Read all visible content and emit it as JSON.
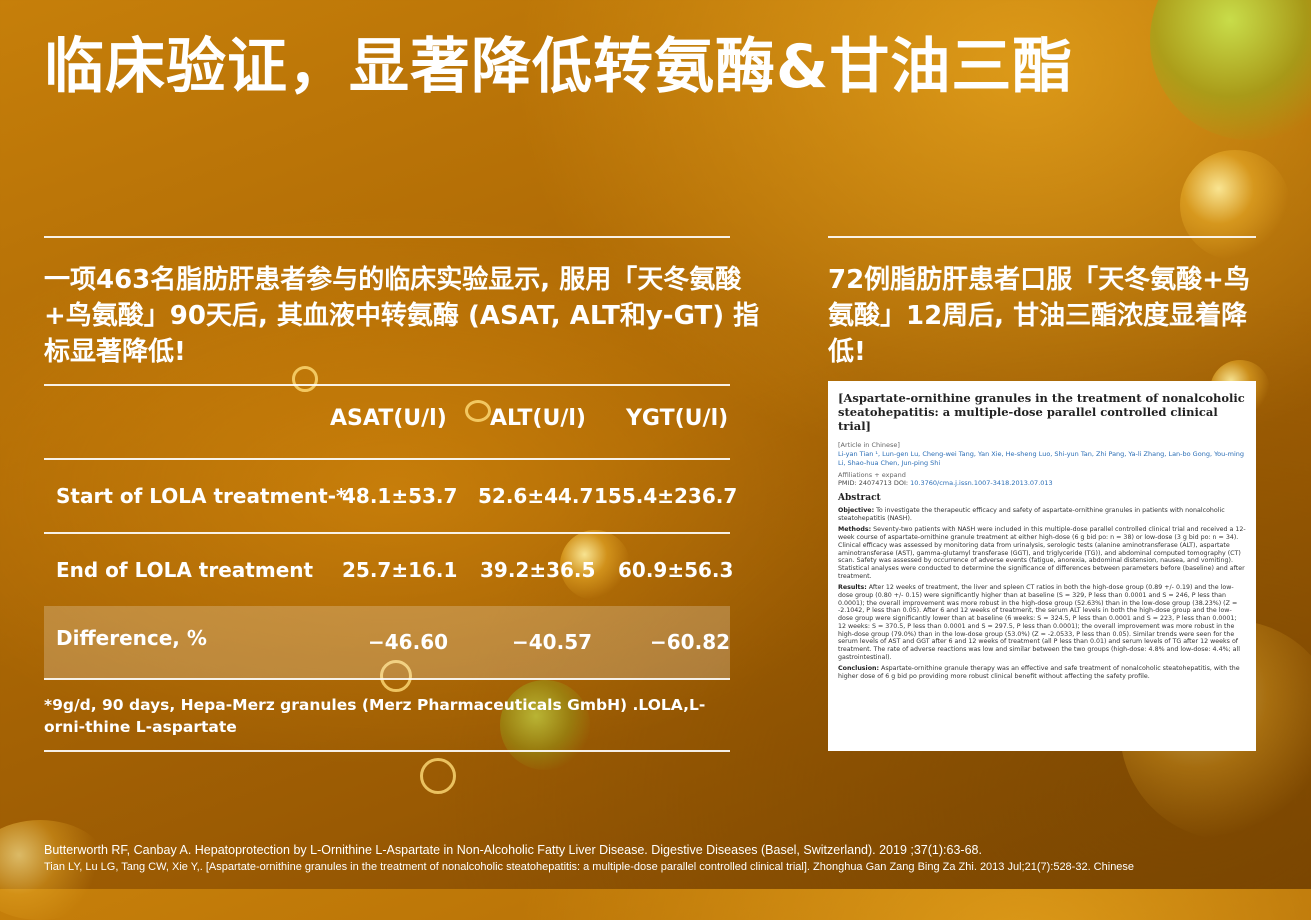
{
  "title": "临床验证，显著降低转氨酶&甘油三酯",
  "left": {
    "lead": "一项463名脂肪肝患者参与的临床实验显示, 服用「天冬氨酸+鸟氨酸」90天后, 其血液中转氨酶 (ASAT, ALT和y-GT) 指标显著降低!",
    "table": {
      "headers": [
        "",
        "ASAT(U/l)",
        "ALT(U/l)",
        "YGT(U/l)"
      ],
      "rows": [
        {
          "label": "Start of LOLA treatment-*",
          "values": [
            "48.1±53.7",
            "52.6±44.7",
            "155.4±236.7"
          ]
        },
        {
          "label": "End of LOLA treatment",
          "values": [
            "25.7±16.1",
            "39.2±36.5",
            "60.9±56.3"
          ]
        },
        {
          "label": "Difference, %",
          "values": [
            "−46.60",
            "−40.57",
            "−60.82"
          ]
        }
      ]
    },
    "footnote": "*9g/d, 90  days, Hepa-Merz  granules (Merz  Pharmaceuticals  GmbH) .LOLA,L-orni-thine L-aspartate"
  },
  "right": {
    "lead": "72例脂肪肝患者口服「天冬氨酸+鸟氨酸」12周后, 甘油三酯浓度显着降低!",
    "paper": {
      "title": "[Aspartate-ornithine granules in the treatment of nonalcoholic steatohepatitis: a multiple-dose parallel controlled clinical trial]",
      "article_lang": "[Article in Chinese]",
      "authors": "Li-yan Tian ¹, Lun-gen Lu, Cheng-wei Tang, Yan Xie, He-sheng Luo, Shi-yun Tan, Zhi Pang, Ya-li Zhang, Lan-bo Gong, You-ming Li, Shao-hua Chen, Jun-ping Shi",
      "affiliations": "Affiliations  + expand",
      "pmid_label": "PMID: 24074713   DOI: ",
      "doi": "10.3760/cma.j.issn.1007-3418.2013.07.013",
      "abstract_heading": "Abstract",
      "objective_label": "Objective:",
      "objective": " To investigate the therapeutic efficacy and safety of aspartate-ornithine granules in patients with nonalcoholic steatohepatitis (NASH).",
      "methods_label": "Methods:",
      "methods": " Seventy-two patients with NASH were included in this multiple-dose parallel controlled clinical trial and received a 12-week course of aspartate-ornithine granule treatment at either high-dose (6 g bid po: n = 38) or low-dose (3 g bid po: n = 34). Clinical efficacy was assessed by monitoring data from urinalysis, serologic tests (alanine aminotransferase (ALT), aspartate aminotransferase (AST), gamma-glutamyl transferase (GGT), and triglyceride (TG)), and abdominal computed tomography (CT) scan. Safety was assessed by occurrence of adverse events (fatigue, anorexia, abdominal distension, nausea, and vomiting). Statistical analyses were conducted to determine the significance of differences between parameters before (baseline) and after treatment.",
      "results_label": "Results:",
      "results": " After 12 weeks of treatment, the liver and spleen CT ratios in both the high-dose group (0.89 +/- 0.19) and the low-dose group (0.80 +/- 0.15) were significantly higher than at baseline (S = 329, P less than 0.0001 and S = 246, P less than 0.0001); the overall improvement was more robust in the high-dose group (52.63%) than in the low-dose group (38.23%) (Z = -2.1042, P less than 0.05). After 6 and 12 weeks of treatment, the serum ALT levels in both the high-dose group and the low-dose group were significantly lower than at baseline (6 weeks: S = 324.5, P less than 0.0001 and S = 223, P less than 0.0001; 12 weeks: S = 370.5, P less than 0.0001 and S = 297.5, P less than 0.0001); the overall improvement was more robust in the high-dose group (79.0%) than in the low-dose group (53.0%) (Z = -2.0533, P less than 0.05). Similar trends were seen for the serum levels of AST and GGT after 6 and 12 weeks of treatment (all P less than 0.01) and serum levels of TG after 12 weeks of treatment. The rate of adverse reactions was low and similar between the two groups (high-dose: 4.8% and low-dose: 4.4%; all gastrointestinal).",
      "conclusion_label": "Conclusion:",
      "conclusion": " Aspartate-ornithine granule therapy was an effective and safe treatment of nonalcoholic steatohepatitis, with the higher dose of 6 g bid po providing more robust clinical benefit without affecting the safety profile."
    }
  },
  "references": {
    "ref1": "Butterworth RF, Canbay A. Hepatoprotection by L-Ornithine L-Aspartate in Non-Alcoholic Fatty Liver Disease. Digestive Diseases (Basel, Switzerland). 2019 ;37(1):63-68.",
    "ref2": "Tian LY, Lu LG, Tang CW, Xie Y,. [Aspartate-ornithine granules in the treatment of nonalcoholic steatohepatitis: a multiple-dose parallel controlled clinical trial]. Zhonghua Gan Zang Bing Za Zhi. 2013 Jul;21(7):528-32. Chinese"
  }
}
